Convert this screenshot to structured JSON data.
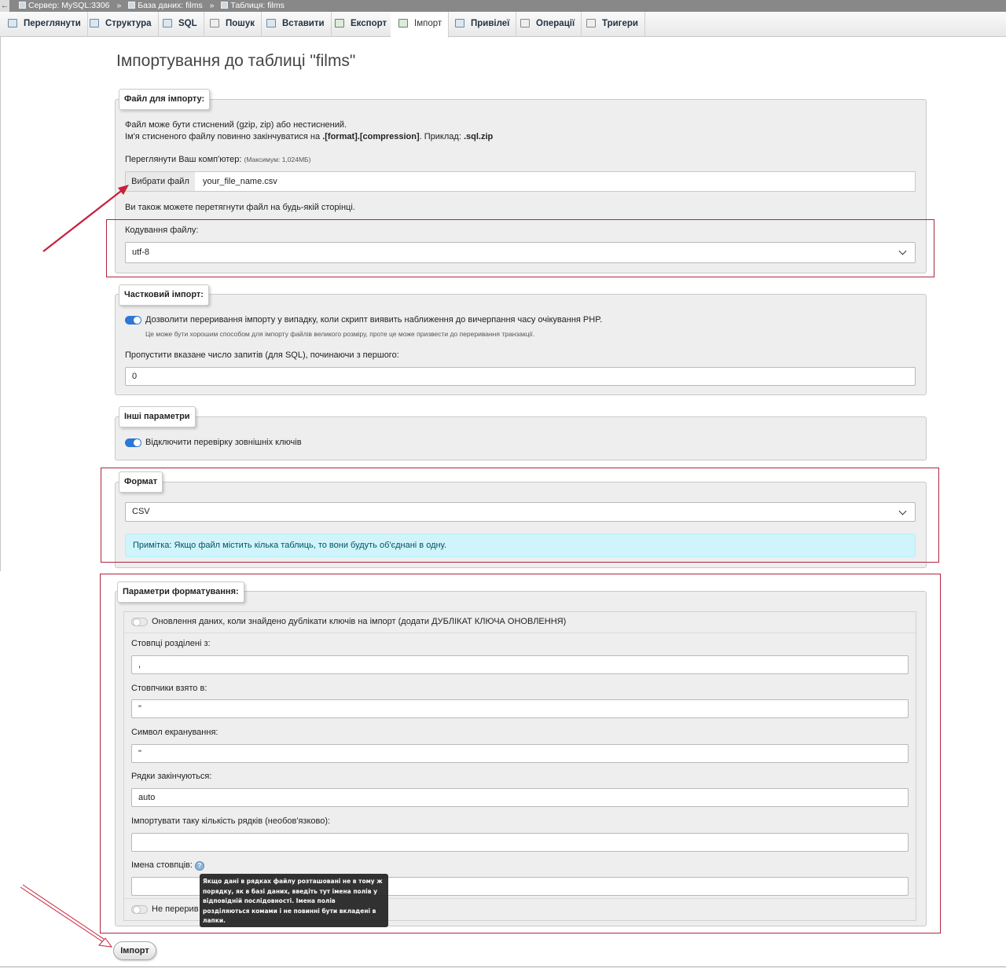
{
  "breadcrumb": {
    "server": "Сервер: MySQL:3306",
    "database": "База даних: films",
    "table": "Таблиця: films",
    "separator": "»"
  },
  "tabs": [
    {
      "label": "Переглянути",
      "icon": "browse-icon"
    },
    {
      "label": "Структура",
      "icon": "structure-icon"
    },
    {
      "label": "SQL",
      "icon": "sql-icon"
    },
    {
      "label": "Пошук",
      "icon": "search-icon"
    },
    {
      "label": "Вставити",
      "icon": "insert-icon"
    },
    {
      "label": "Експорт",
      "icon": "export-icon"
    },
    {
      "label": "Імпорт",
      "icon": "import-icon",
      "active": true
    },
    {
      "label": "Привілеї",
      "icon": "privileges-icon"
    },
    {
      "label": "Операції",
      "icon": "operations-icon"
    },
    {
      "label": "Тригери",
      "icon": "triggers-icon"
    }
  ],
  "page_title": "Імпортування до таблиці \"films\"",
  "file_section": {
    "legend": "Файл для імпорту:",
    "compression_line1": "Файл може бути стиснений (gzip, zip) або нестиснений.",
    "compression_line2_a": "Ім'я стисненого файлу повинно закінчуватися на ",
    "compression_line2_b": ".[format].[compression]",
    "compression_line2_c": ". Приклад: ",
    "compression_line2_d": ".sql.zip",
    "browse_label": "Переглянути Ваш комп'ютер: ",
    "browse_max": "(Максимум: 1,024МБ)",
    "choose_button": "Вибрати файл",
    "file_name": "your_file_name.csv",
    "drag_hint": "Ви також можете перетягнути файл на будь-якій сторінці.",
    "encoding_label": "Кодування файлу:",
    "encoding_value": "utf-8"
  },
  "partial_section": {
    "legend": "Частковий імпорт:",
    "allow_interrupt_label": "Дозволити переривання імпорту у випадку, коли скрипт виявить наближення до вичерпання часу очікування PHP.",
    "allow_interrupt_note": "Це може бути хорошим способом для імпорту файлів великого розміру, проте це може призвести до переривання транзакції.",
    "allow_interrupt_on": true,
    "skip_label": "Пропустити вказане число запитів (для SQL), починаючи з першого:",
    "skip_value": "0"
  },
  "other_section": {
    "legend": "Інші параметри",
    "fk_label": "Відключити перевірку зовнішніх ключів",
    "fk_on": true
  },
  "format_section": {
    "legend": "Формат",
    "format_value": "CSV",
    "note": "Примітка: Якщо файл містить кілька таблиць, то вони будуть об'єднані в одну."
  },
  "format_options": {
    "legend": "Параметри форматування:",
    "update_label": "Оновлення даних, коли знайдено дублікати ключів на імпорт (додати ДУБЛІКАТ КЛЮЧА ОНОВЛЕННЯ)",
    "update_on": false,
    "columns_sep_label": "Стовпці розділені з:",
    "columns_sep_value": ",",
    "enclosed_label": "Стовпчики взято в:",
    "enclosed_value": "\"",
    "escape_label": "Символ екранування:",
    "escape_value": "\"",
    "lines_label": "Рядки закінчуються:",
    "lines_value": "auto",
    "rows_label": "Імпортувати таку кількість рядків (необов'язково):",
    "rows_value": "",
    "colnames_label": "Імена стовпців:",
    "colnames_value": "",
    "last_label": "Не перерив",
    "last_on": false,
    "tooltip": "Якщо дані в рядках файлу розташовані не в тому ж порядку, як в базі даних, введіть тут імена полів у відповідній послідовності. Імена полів розділяються комами і не повинні бути вкладені в лапки."
  },
  "import_button": "Імпорт",
  "colors": {
    "highlight_box": "#b0253f",
    "toggle_on": "#2d77d6",
    "note_bg": "#cff4fc"
  }
}
